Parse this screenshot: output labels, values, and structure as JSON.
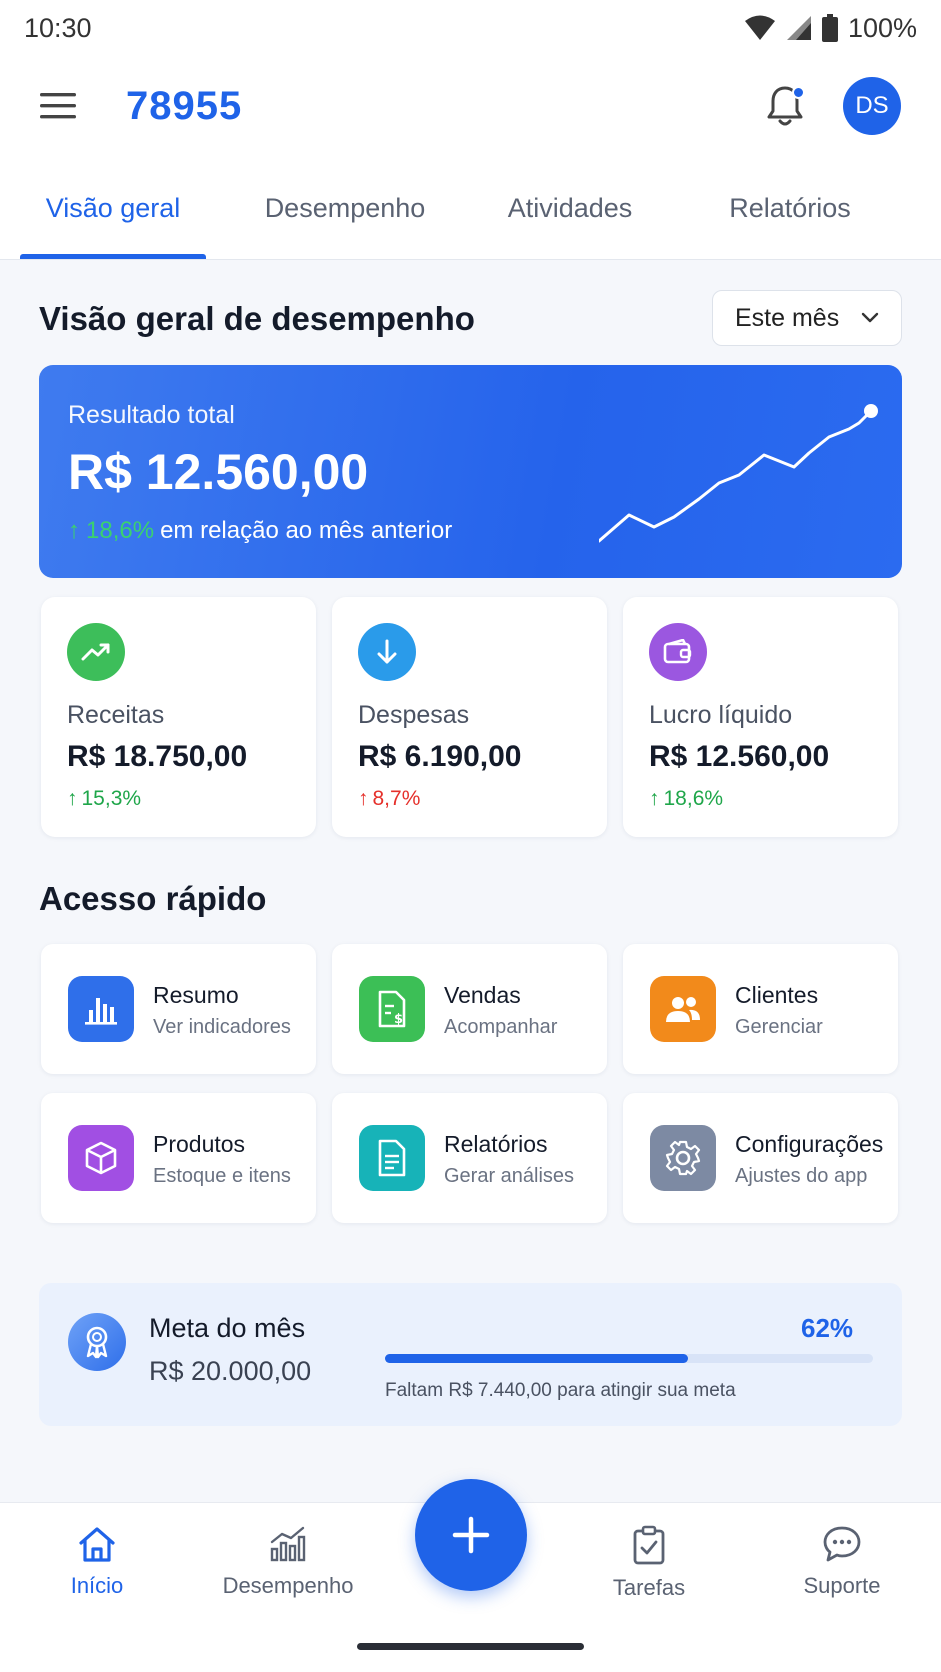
{
  "status_bar": {
    "time": "10:30",
    "battery": "100%"
  },
  "app_bar": {
    "title": "78955",
    "avatar_initials": "DS"
  },
  "tabs": [
    {
      "label": "Visão geral",
      "active": true
    },
    {
      "label": "Desempenho",
      "active": false
    },
    {
      "label": "Atividades",
      "active": false
    },
    {
      "label": "Relatórios",
      "active": false
    }
  ],
  "overview": {
    "title": "Visão geral de desempenho",
    "period": "Este mês",
    "hero": {
      "label": "Resultado total",
      "value": "R$ 12.560,00",
      "change": "18,6%",
      "change_text": "em relação ao mês anterior"
    },
    "stats": [
      {
        "label": "Receitas",
        "value": "R$ 18.750,00",
        "change": "15,3%",
        "icon": "trending-up-icon"
      },
      {
        "label": "Despesas",
        "value": "R$ 6.190,00",
        "change": "8,7%",
        "icon": "arrow-down-icon"
      },
      {
        "label": "Lucro líquido",
        "value": "R$ 12.560,00",
        "change": "18,6%",
        "icon": "wallet-icon"
      }
    ]
  },
  "quick_access": {
    "title": "Acesso rápido",
    "items": [
      {
        "title": "Resumo",
        "subtitle": "Ver indicadores",
        "icon": "bar-chart-icon"
      },
      {
        "title": "Vendas",
        "subtitle": "Acompanhar",
        "icon": "sales-document-icon"
      },
      {
        "title": "Clientes",
        "subtitle": "Gerenciar",
        "icon": "users-icon"
      },
      {
        "title": "Produtos",
        "subtitle": "Estoque e itens",
        "icon": "box-icon"
      },
      {
        "title": "Relatórios",
        "subtitle": "Gerar análises",
        "icon": "report-icon"
      },
      {
        "title": "Configurações",
        "subtitle": "Ajustes do app",
        "icon": "gear-icon"
      }
    ]
  },
  "goal": {
    "title": "Meta do mês",
    "value": "R$ 20.000,00",
    "percent_label": "62%",
    "progress": 0.62,
    "note": "Faltam R$ 7.440,00 para atingir sua meta"
  },
  "bottom_nav": [
    {
      "label": "Início",
      "active": true,
      "icon": "home-icon"
    },
    {
      "label": "Desempenho",
      "active": false,
      "icon": "analytics-icon"
    },
    {
      "label": "Tarefas",
      "active": false,
      "icon": "clipboard-icon"
    },
    {
      "label": "Suporte",
      "active": false,
      "icon": "chat-icon"
    }
  ],
  "colors": {
    "primary": "#1F63E8",
    "positive": "#1FA64A",
    "negative": "#E5302B",
    "receitas": "#3DBE5A",
    "despesas": "#2A9BEA",
    "lucro": "#9B57E0",
    "resumo": "#2F6FEA",
    "vendas": "#3CBF56",
    "clientes": "#F28A1B",
    "produtos": "#A14FE3",
    "relatorios": "#17B3B8",
    "configuracoes": "#7D8AA3"
  }
}
